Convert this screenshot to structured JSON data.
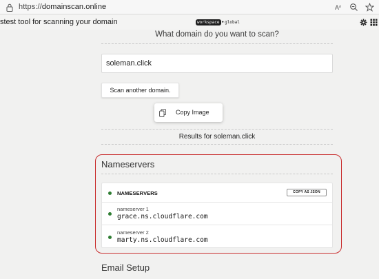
{
  "browser": {
    "url_scheme": "https://",
    "url_host": "domainscan.online",
    "icons": [
      "lock-icon",
      "read-aloud-icon",
      "zoom-icon",
      "favorites-icon"
    ]
  },
  "header": {
    "tagline": "stest tool for scanning your domain",
    "logo": {
      "badge": "workspace",
      "sep": "•",
      "rest": "global"
    },
    "icons": [
      "gear-icon",
      "grid-icon"
    ]
  },
  "scan": {
    "question": "What domain do you want to scan?",
    "input_value": "soleman.click",
    "button_label": "Scan another domain."
  },
  "context_menu": {
    "item_label": "Copy Image",
    "item_icon": "copy-icon"
  },
  "results": {
    "heading": "Results for soleman.click"
  },
  "nameservers": {
    "section_title": "Nameservers",
    "card_title": "NAMESERVERS",
    "copy_button": "COPY AS JSON",
    "status_color": "#2e7d32",
    "items": [
      {
        "label": "nameserver 1",
        "value": "grace.ns.cloudflare.com"
      },
      {
        "label": "nameserver 2",
        "value": "marty.ns.cloudflare.com"
      }
    ]
  },
  "email": {
    "section_title": "Email Setup"
  },
  "colors": {
    "highlight_border": "#c82a2a",
    "page_bg": "#f1f1f0"
  }
}
